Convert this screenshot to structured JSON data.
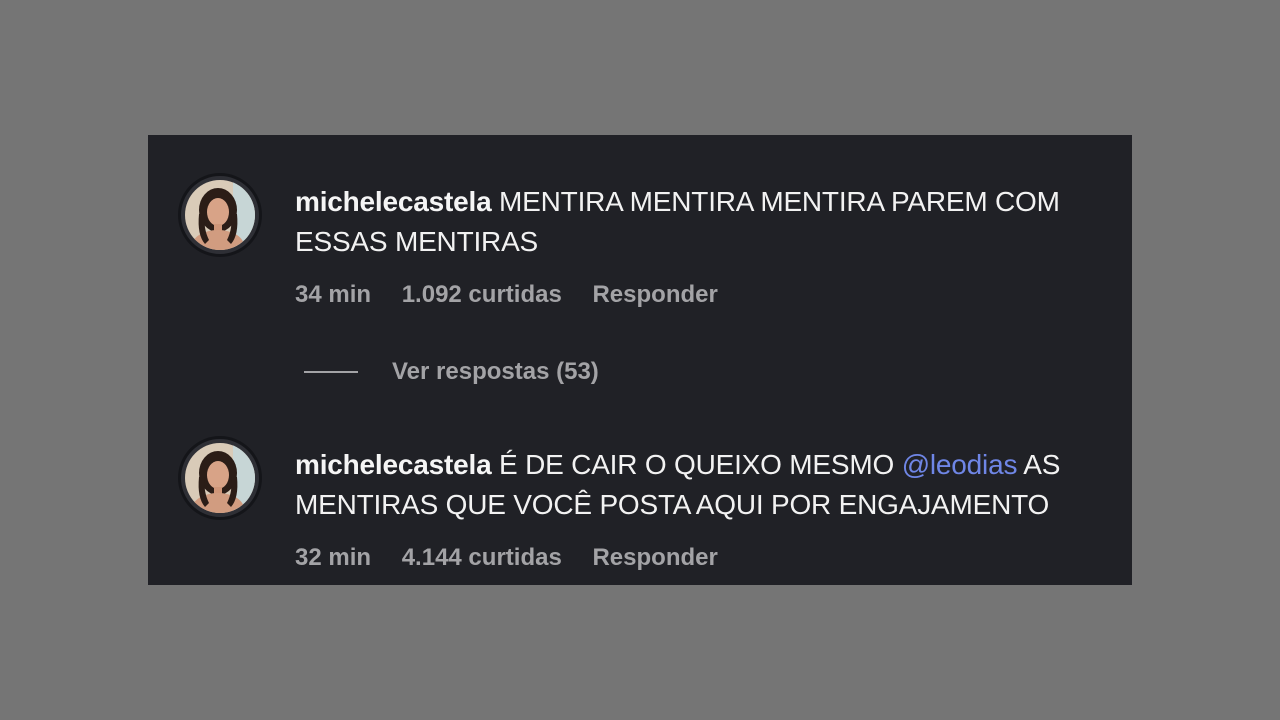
{
  "comments": [
    {
      "username": "michelecastela",
      "text": "MENTIRA MENTIRA MENTIRA PAREM COM ESSAS MENTIRAS",
      "time": "34 min",
      "likes": "1.092 curtidas",
      "reply_label": "Responder"
    },
    {
      "username": "michelecastela",
      "text_before": "É DE CAIR O QUEIXO MESMO",
      "mention": "@leodias",
      "text_after": "AS MENTIRAS QUE VOCÊ POSTA AQUI POR ENGAJAMENTO",
      "time": "32 min",
      "likes": "4.144 curtidas",
      "reply_label": "Responder"
    }
  ],
  "view_replies_label": "Ver respostas (53)",
  "colors": {
    "page_background": "#757575",
    "panel_background": "#202126",
    "mention": "#6f86e6",
    "secondary_text": "#a3a3a6"
  },
  "icons": {
    "avatar": "profile-photo-avatar"
  }
}
